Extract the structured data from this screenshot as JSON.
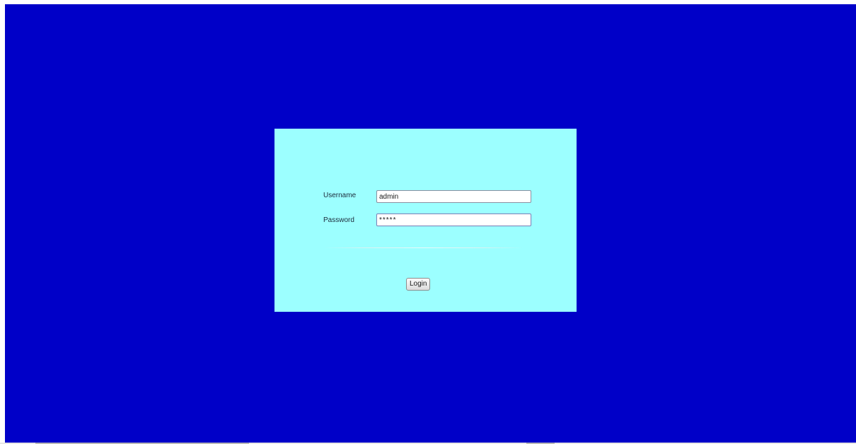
{
  "colors": {
    "background": "#0000c8",
    "panel": "#9cffff"
  },
  "login": {
    "username_label": "Username",
    "username_value": "admin",
    "password_label": "Password",
    "password_value": "*****",
    "login_button": "Login"
  }
}
